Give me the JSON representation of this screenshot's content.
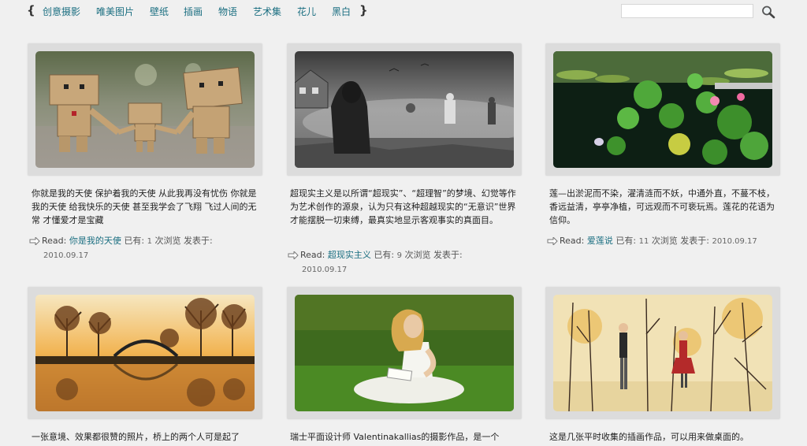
{
  "nav": {
    "open_brace": "{",
    "close_brace": "}",
    "items": [
      "创意摄影",
      "唯美图片",
      "壁纸",
      "插画",
      "物语",
      "艺术集",
      "花儿",
      "黑白"
    ]
  },
  "search": {
    "placeholder": ""
  },
  "icons": {
    "search": "magnifier-icon",
    "read": "arrow-icon"
  },
  "posts": [
    {
      "description": "你就是我的天使 保护着我的天使 从此我再没有忧伤 你就是我的天使 给我快乐的天使 甚至我学会了飞翔 飞过人间的无常 才懂爱才是宝藏",
      "read_label": "Read:",
      "title": "你是我的天使",
      "views_prefix": "已有:",
      "views": "1",
      "views_suffix": "次浏览 发表于:",
      "date": "2010.09.17"
    },
    {
      "description": "超现实主义是以所谓“超现实”、“超理智”的梦境、幻觉等作为艺术创作的源泉，认为只有这种超越现实的“无意识”世界才能摆脱一切束缚，最真实地显示客观事实的真面目。",
      "read_label": "Read:",
      "title": "超现实主义",
      "views_prefix": "已有:",
      "views": "9",
      "views_suffix": "次浏览 发表于:",
      "date": "2010.09.17"
    },
    {
      "description": "莲—出淤泥而不染，濯清涟而不妖，中通外直，不蔓不枝，香远益清，亭亭净植，可远观而不可亵玩焉。莲花的花语为信仰。",
      "read_label": "Read:",
      "title": "爱莲说",
      "views_prefix": "已有:",
      "views": "11",
      "views_suffix": "次浏览 发表于:",
      "date": "2010.09.17"
    },
    {
      "description": "一张意境、效果都很赞的照片，桥上的两个人可是起了"
    },
    {
      "description": "瑞士平面设计师 Valentinakallias的摄影作品，是一个"
    },
    {
      "description": "这是几张平时收集的插画作品，可以用来做桌面的。"
    }
  ]
}
